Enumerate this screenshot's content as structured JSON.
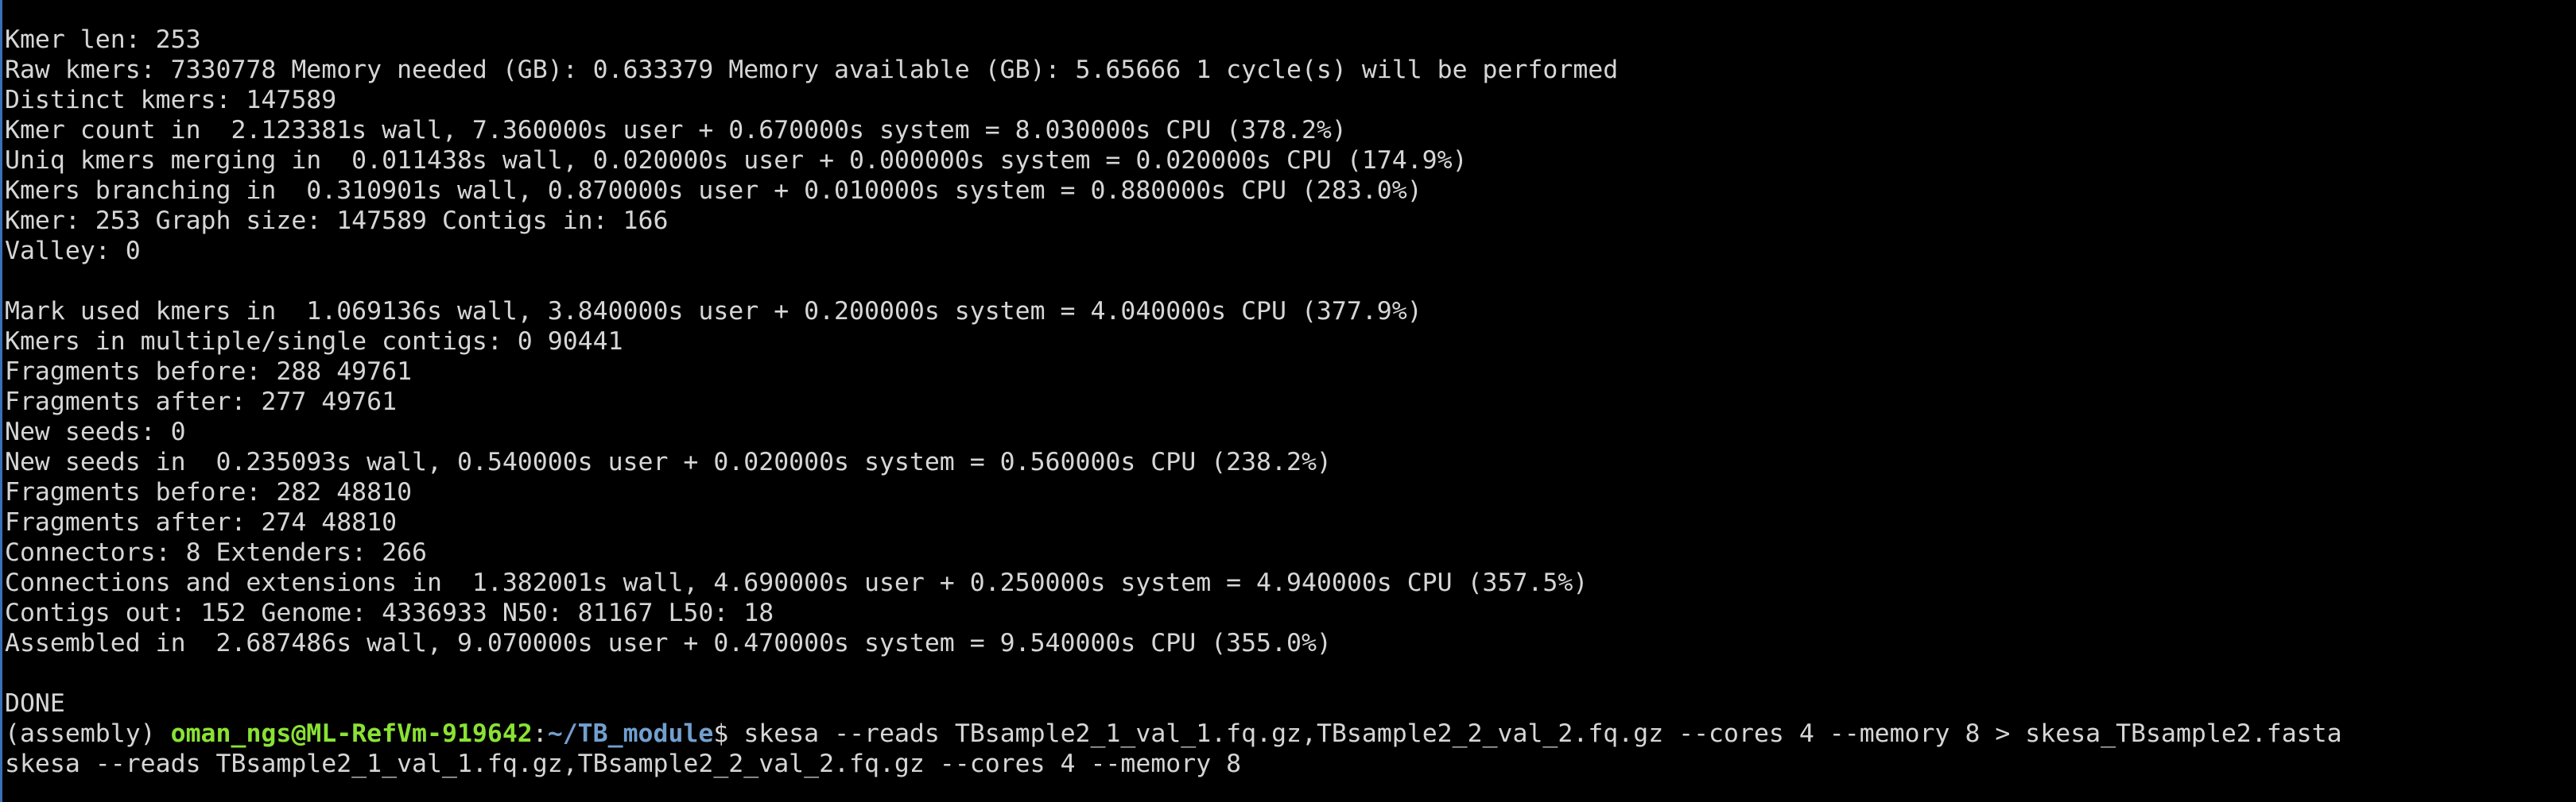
{
  "colors": {
    "background": "#000000",
    "text": "#d6d6d6",
    "prompt_user": "#8ae234",
    "prompt_path": "#729fcf"
  },
  "output_lines": [
    "Kmer len: 253",
    "Raw kmers: 7330778 Memory needed (GB): 0.633379 Memory available (GB): 5.65666 1 cycle(s) will be performed",
    "Distinct kmers: 147589",
    "Kmer count in  2.123381s wall, 7.360000s user + 0.670000s system = 8.030000s CPU (378.2%)",
    "Uniq kmers merging in  0.011438s wall, 0.020000s user + 0.000000s system = 0.020000s CPU (174.9%)",
    "Kmers branching in  0.310901s wall, 0.870000s user + 0.010000s system = 0.880000s CPU (283.0%)",
    "Kmer: 253 Graph size: 147589 Contigs in: 166",
    "Valley: 0",
    "",
    "Mark used kmers in  1.069136s wall, 3.840000s user + 0.200000s system = 4.040000s CPU (377.9%)",
    "Kmers in multiple/single contigs: 0 90441",
    "Fragments before: 288 49761",
    "Fragments after: 277 49761",
    "New seeds: 0",
    "New seeds in  0.235093s wall, 0.540000s user + 0.020000s system = 0.560000s CPU (238.2%)",
    "Fragments before: 282 48810",
    "Fragments after: 274 48810",
    "Connectors: 8 Extenders: 266",
    "Connections and extensions in  1.382001s wall, 4.690000s user + 0.250000s system = 4.940000s CPU (357.5%)",
    "Contigs out: 152 Genome: 4336933 N50: 81167 L50: 18",
    "Assembled in  2.687486s wall, 9.070000s user + 0.470000s system = 9.540000s CPU (355.0%)",
    "",
    "DONE"
  ],
  "prompt": {
    "env": "(assembly) ",
    "user_host": "oman_ngs@ML-RefVm-919642",
    "separator": ":",
    "path": "~/TB_module",
    "symbol": "$ ",
    "command": "skesa --reads TBsample2_1_val_1.fq.gz,TBsample2_2_val_2.fq.gz --cores 4 --memory 8 > skesa_TBsample2.fasta"
  },
  "last_output_line": "skesa --reads TBsample2_1_val_1.fq.gz,TBsample2_2_val_2.fq.gz --cores 4 --memory 8"
}
